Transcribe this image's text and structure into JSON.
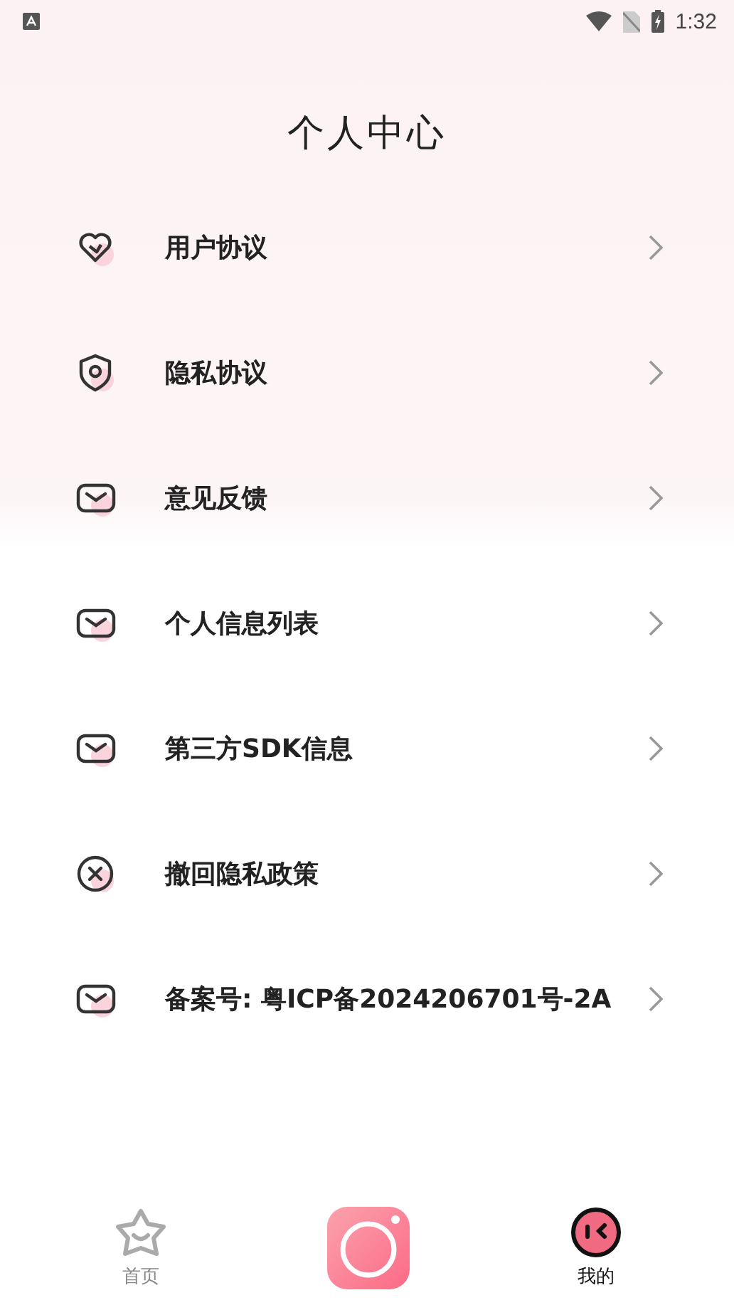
{
  "status_bar": {
    "time": "1:32"
  },
  "title": "个人中心",
  "menu": [
    {
      "label": "用户协议",
      "kind": "heart"
    },
    {
      "label": "隐私协议",
      "kind": "shield"
    },
    {
      "label": "意见反馈",
      "kind": "mail"
    },
    {
      "label": "个人信息列表",
      "kind": "mail"
    },
    {
      "label": "第三方SDK信息",
      "kind": "mail"
    },
    {
      "label": "撤回隐私政策",
      "kind": "cancel"
    },
    {
      "label": "备案号: 粤ICP备2024206701号-2A",
      "kind": "mail"
    }
  ],
  "tab_bar": [
    {
      "kind": "home",
      "label": "首页",
      "selected": false
    },
    {
      "kind": "camera"
    },
    {
      "kind": "profile",
      "label": "我的",
      "selected": true
    }
  ]
}
